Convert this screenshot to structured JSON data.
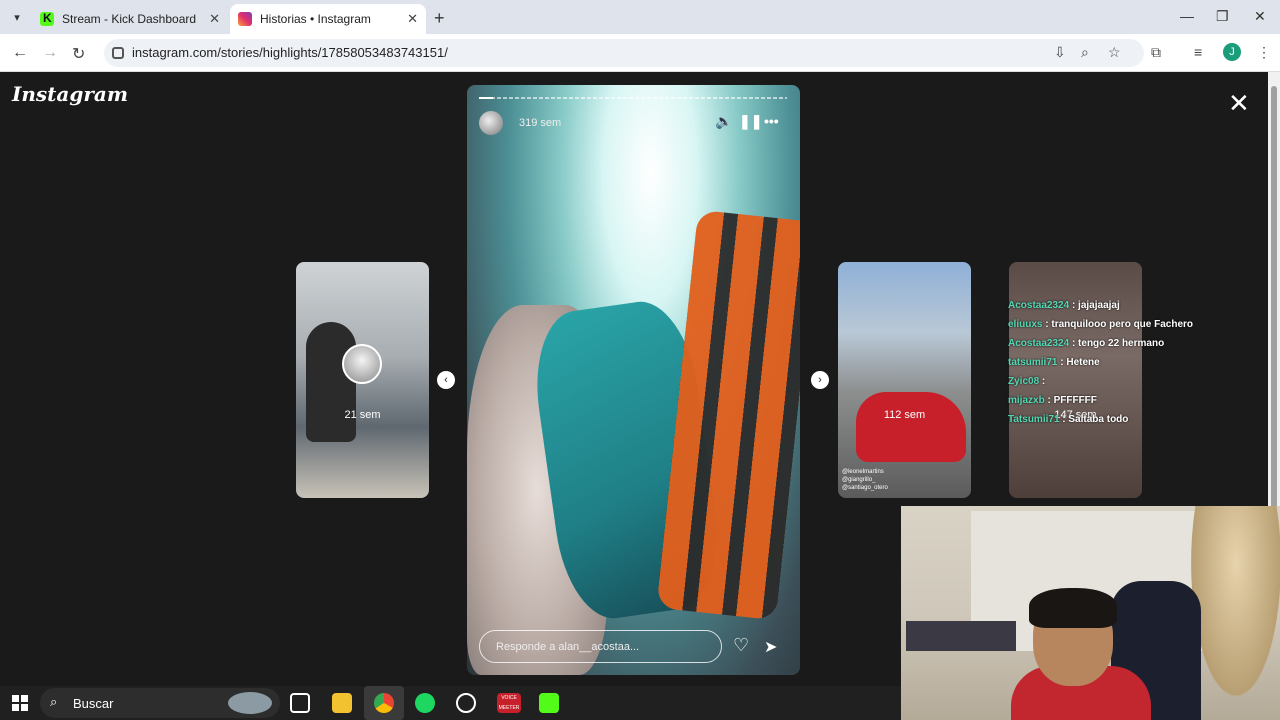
{
  "browser": {
    "tabs": [
      {
        "title": "Stream - Kick Dashboard",
        "favicon": "kick-icon"
      },
      {
        "title": "Historias • Instagram",
        "favicon": "instagram-icon",
        "active": true
      }
    ],
    "url": "instagram.com/stories/highlights/17858053483743151/",
    "profile_initial": "J"
  },
  "instagram": {
    "logo": "Instagram",
    "main_story": {
      "time": "319 sem",
      "reply_placeholder": "Responde a alan__acostaa..."
    },
    "thumbs": [
      {
        "label": "21 sem"
      },
      {
        "label": "112 sem",
        "tags": [
          "@leonelmartins",
          "@giangrillo_",
          "@santiago_otero"
        ]
      },
      {
        "label": "147 sem"
      }
    ]
  },
  "chat": [
    {
      "user": "Acostaa2324",
      "msg": ": jajajaajaj"
    },
    {
      "user": "eliuuxs",
      "msg": ": tranquilooo pero que Fachero"
    },
    {
      "user": "Acostaa2324",
      "msg": ": tengo 22 hermano"
    },
    {
      "user": "tatsumii71",
      "msg": ": Hetene"
    },
    {
      "user": "Zyic08",
      "msg": ":"
    },
    {
      "user": "mijazxb",
      "msg": ": PFFFFFF"
    },
    {
      "user": "Tatsumii71",
      "msg": ": Saltaba todo"
    }
  ],
  "taskbar": {
    "search_placeholder": "Buscar",
    "voicemeeter_label": "VOICE MEETER"
  },
  "colors": {
    "kick_green": "#53fc18",
    "chat_user": "#53d8b4"
  }
}
